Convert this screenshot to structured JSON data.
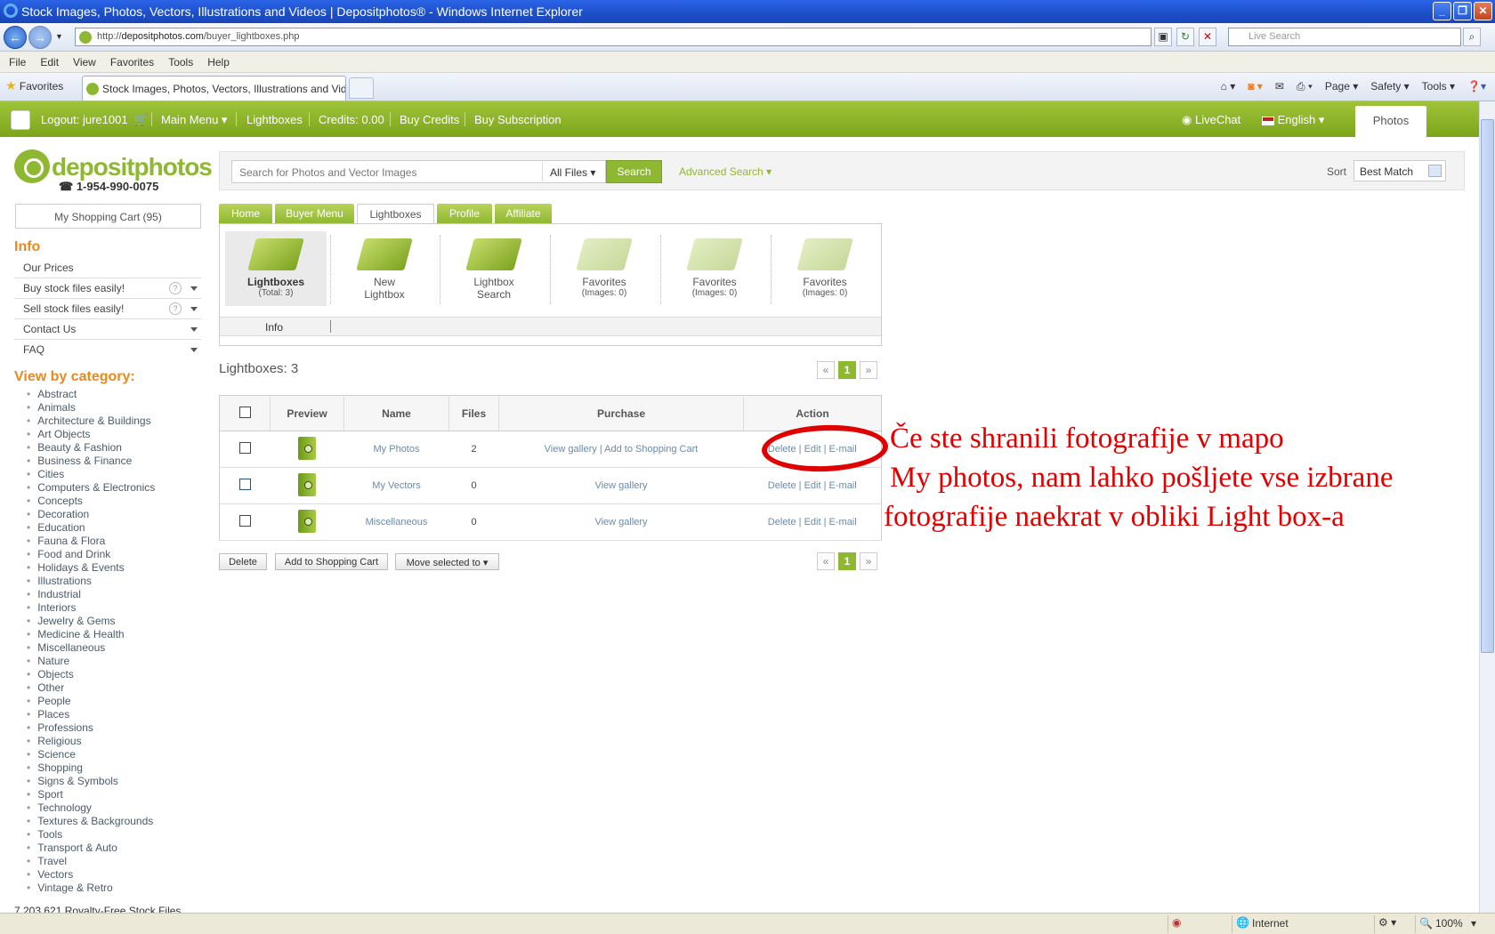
{
  "window": {
    "title": "Stock Images, Photos, Vectors, Illustrations and Videos | Depositphotos® - Windows Internet Explorer"
  },
  "address": {
    "prefix": "http://",
    "host": "depositphotos.com",
    "path": "/buyer_lightboxes.php",
    "search_placeholder": "Live Search"
  },
  "menu": [
    "File",
    "Edit",
    "View",
    "Favorites",
    "Tools",
    "Help"
  ],
  "tabs": {
    "favorites": "Favorites",
    "page_tab": "Stock Images, Photos, Vectors, Illustrations and Vide...",
    "commands": [
      "Page",
      "Safety",
      "Tools"
    ]
  },
  "sitebar": {
    "logout": "Logout: jure1001",
    "main_menu": "Main Menu",
    "lightboxes": "Lightboxes",
    "credits": "Credits: 0.00",
    "buy_credits": "Buy Credits",
    "buy_subscription": "Buy Subscription",
    "livechat": "LiveChat",
    "language": "English",
    "photos_tab": "Photos"
  },
  "sidebar": {
    "brand": "depositphotos",
    "phone": "1-954-990-0075",
    "cart": "My Shopping Cart (95)",
    "info_heading": "Info",
    "info_links": [
      "Our Prices",
      "Buy stock files easily!",
      "Sell stock files easily!",
      "Contact Us",
      "FAQ"
    ],
    "category_heading": "View by category:",
    "categories": [
      "Abstract",
      "Animals",
      "Architecture & Buildings",
      "Art Objects",
      "Beauty & Fashion",
      "Business & Finance",
      "Cities",
      "Computers & Electronics",
      "Concepts",
      "Decoration",
      "Education",
      "Fauna & Flora",
      "Food and Drink",
      "Holidays & Events",
      "Illustrations",
      "Industrial",
      "Interiors",
      "Jewelry & Gems",
      "Medicine & Health",
      "Miscellaneous",
      "Nature",
      "Objects",
      "Other",
      "People",
      "Places",
      "Professions",
      "Religious",
      "Science",
      "Shopping",
      "Signs & Symbols",
      "Sport",
      "Technology",
      "Textures & Backgrounds",
      "Tools",
      "Transport & Auto",
      "Travel",
      "Vectors",
      "Vintage & Retro"
    ],
    "stock_count": "7,203,621 Royalty-Free Stock Files"
  },
  "search": {
    "placeholder": "Search for Photos and Vector Images",
    "filter": "All Files",
    "button": "Search",
    "advanced": "Advanced Search",
    "sort_label": "Sort",
    "sort_value": "Best Match"
  },
  "nav_tabs": [
    "Home",
    "Buyer Menu",
    "Lightboxes",
    "Profile",
    "Affiliate"
  ],
  "tiles": [
    {
      "t1": "Lightboxes",
      "t2": "(Total: 3)"
    },
    {
      "t1": "New",
      "t2": "Lightbox"
    },
    {
      "t1": "Lightbox",
      "t2": "Search"
    },
    {
      "t1": "Favorites",
      "t2": "(Images: 0)"
    },
    {
      "t1": "Favorites",
      "t2": "(Images: 0)"
    },
    {
      "t1": "Favorites",
      "t2": "(Images: 0)"
    }
  ],
  "info_strip": "Info",
  "lightboxes": {
    "count": "Lightboxes: 3",
    "page": "1",
    "prev": "«",
    "next": "»",
    "headers": [
      "Preview",
      "Name",
      "Files",
      "Purchase",
      "Action"
    ],
    "rows": [
      {
        "name": "My Photos",
        "files": "2",
        "view": "View gallery",
        "add": "Add to Shopping Cart",
        "delete": "Delete",
        "edit": "Edit",
        "email": "E-mail"
      },
      {
        "name": "My Vectors",
        "files": "0",
        "view": "View gallery",
        "add": "",
        "delete": "Delete",
        "edit": "Edit",
        "email": "E-mail"
      },
      {
        "name": "Miscellaneous",
        "files": "0",
        "view": "View gallery",
        "add": "",
        "delete": "Delete",
        "edit": "Edit",
        "email": "E-mail"
      }
    ],
    "actions": {
      "delete": "Delete",
      "add_cart": "Add to Shopping Cart",
      "move": "Move selected to"
    }
  },
  "annotation": {
    "line1": "Če ste shranili fotografije v mapo",
    "line2": "My photos, nam lahko pošljete vse izbrane",
    "line3": "fotografije naekrat v obliki Light box-a",
    "color": "#e00000"
  },
  "status": {
    "zone": "Internet",
    "zoom": "100%"
  }
}
